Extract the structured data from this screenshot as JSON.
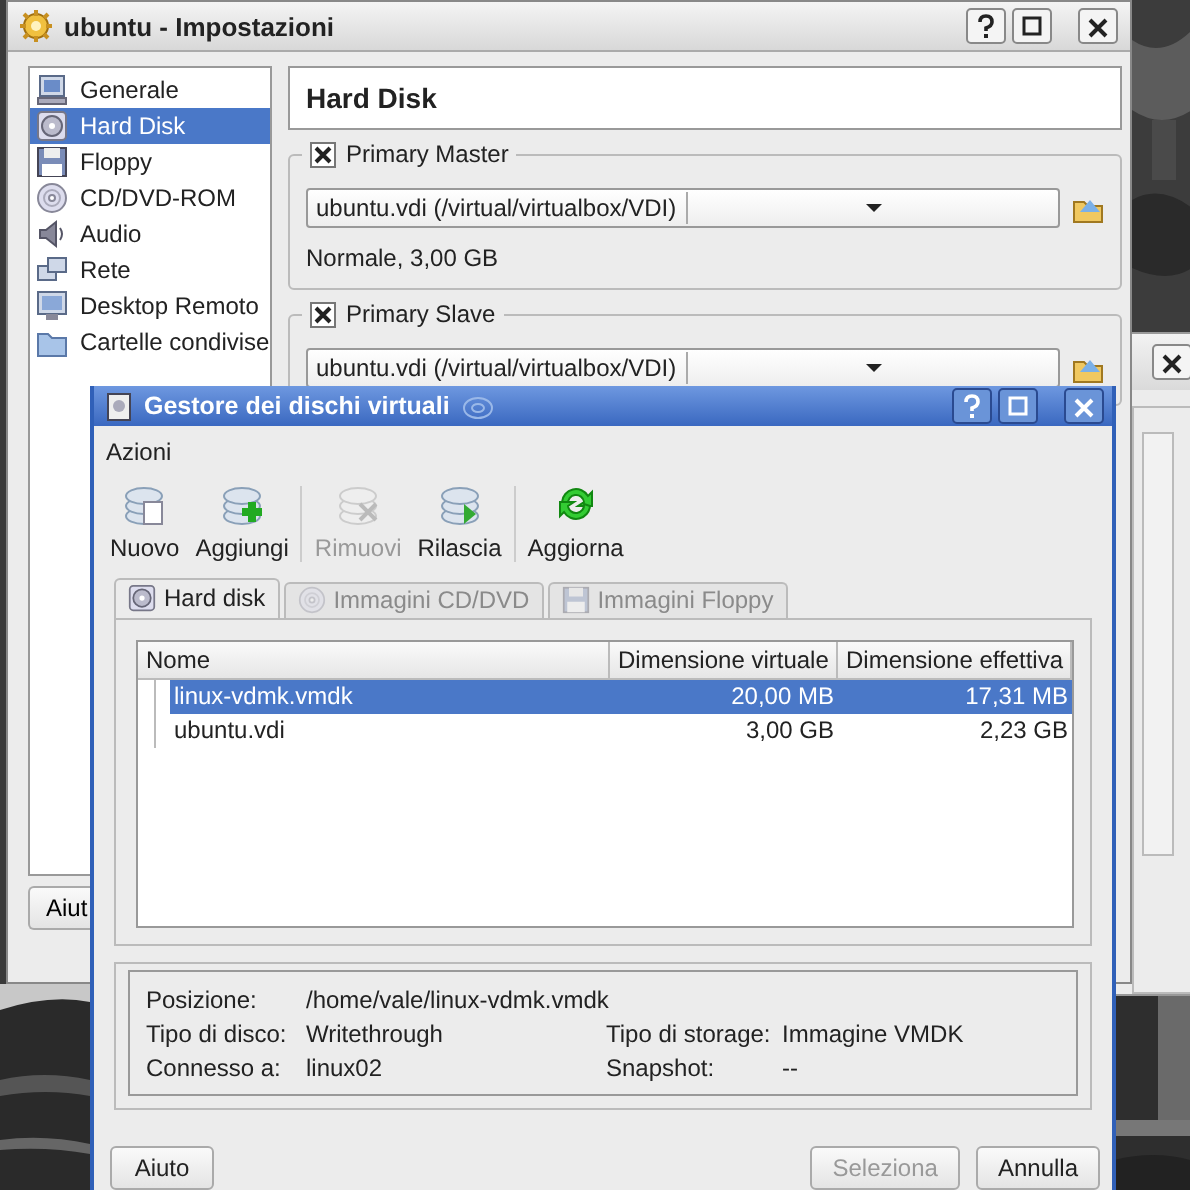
{
  "settings_window": {
    "title": "ubuntu - Impostazioni",
    "sidebar": {
      "items": [
        {
          "label": "Generale",
          "kind": "monitor",
          "selected": false
        },
        {
          "label": "Hard Disk",
          "kind": "disk",
          "selected": true
        },
        {
          "label": "Floppy",
          "kind": "floppy",
          "selected": false
        },
        {
          "label": "CD/DVD-ROM",
          "kind": "cd",
          "selected": false
        },
        {
          "label": "Audio",
          "kind": "audio",
          "selected": false
        },
        {
          "label": "Rete",
          "kind": "network",
          "selected": false
        },
        {
          "label": "Desktop Remoto",
          "kind": "remote",
          "selected": false
        },
        {
          "label": "Cartelle condivise",
          "kind": "folder",
          "selected": false
        }
      ]
    },
    "page_title": "Hard Disk",
    "groups": [
      {
        "label": "Primary Master",
        "checked": true,
        "combo_value": "ubuntu.vdi (/virtual/virtualbox/VDI)",
        "info": "Normale, 3,00 GB"
      },
      {
        "label": "Primary Slave",
        "checked": true,
        "combo_value": "ubuntu.vdi (/virtual/virtualbox/VDI)"
      }
    ],
    "help_button": "Aiut"
  },
  "manager_window": {
    "title": "Gestore dei dischi virtuali",
    "menu": [
      "Azioni"
    ],
    "toolbar": [
      {
        "label": "Nuovo",
        "kind": "new",
        "disabled": false,
        "separator_before": false
      },
      {
        "label": "Aggiungi",
        "kind": "add",
        "disabled": false,
        "separator_before": false
      },
      {
        "label": "Rimuovi",
        "kind": "remove",
        "disabled": true,
        "separator_before": true
      },
      {
        "label": "Rilascia",
        "kind": "release",
        "disabled": false,
        "separator_before": false
      },
      {
        "label": "Aggiorna",
        "kind": "refresh",
        "disabled": false,
        "separator_before": true
      }
    ],
    "tabs": [
      {
        "label": "Hard disk",
        "kind": "disk",
        "selected": true,
        "disabled": false
      },
      {
        "label": "Immagini CD/DVD",
        "kind": "cd",
        "selected": false,
        "disabled": true
      },
      {
        "label": "Immagini Floppy",
        "kind": "floppy",
        "selected": false,
        "disabled": true
      }
    ],
    "table": {
      "columns": [
        "Nome",
        "Dimensione virtuale",
        "Dimensione effettiva"
      ],
      "rows": [
        {
          "cells": [
            "linux-vdmk.vmdk",
            "20,00 MB",
            "17,31 MB"
          ],
          "selected": true
        },
        {
          "cells": [
            "ubuntu.vdi",
            "3,00 GB",
            "2,23 GB"
          ],
          "selected": false
        }
      ]
    },
    "details": [
      [
        {
          "label": "Posizione:",
          "value": "/home/vale/linux-vdmk.vmdk"
        }
      ],
      [
        {
          "label": "Tipo di disco:",
          "value": "Writethrough"
        },
        {
          "label": "Tipo di storage:",
          "value": "Immagine VMDK"
        }
      ],
      [
        {
          "label": "Connesso a:",
          "value": "linux02"
        },
        {
          "label": "Snapshot:",
          "value": "--"
        }
      ]
    ],
    "buttons": [
      {
        "label": "Aiuto",
        "disabled": false
      },
      {
        "label": "Seleziona",
        "disabled": true
      },
      {
        "label": "Annulla",
        "disabled": false
      }
    ]
  }
}
